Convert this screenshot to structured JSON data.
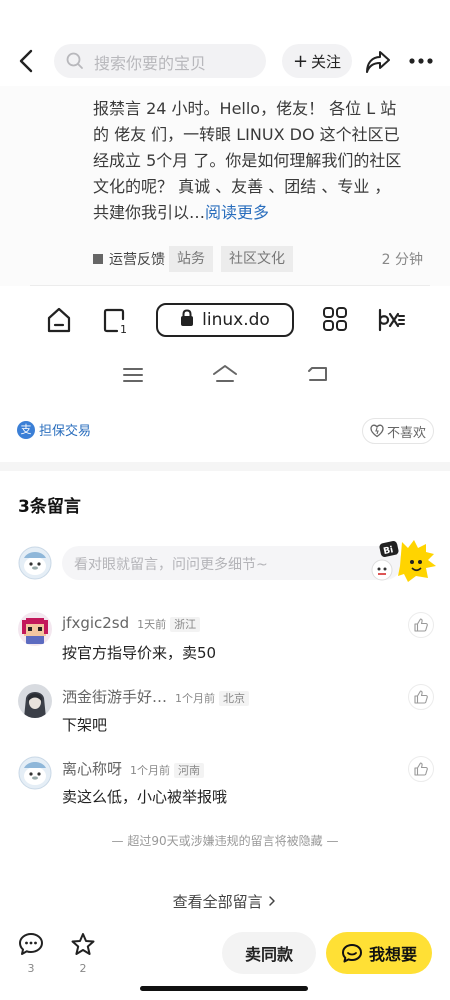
{
  "header": {
    "search_placeholder": "搜索你要的宝贝",
    "follow_label": "关注",
    "follow_plus": "+"
  },
  "post_preview": {
    "paragraph": "报禁言 24 小时。Hello，佬友！ 各位 L 站 的 佬友 们，一转眼 LINUX DO 这个社区已经成立 5个月 了。你是如何理解我们的社区文化的呢？ 真诚 、友善 、团结 、专业 ，共建你我引以…",
    "read_more": "阅读更多",
    "category": "运营反馈",
    "tags": [
      "站务",
      "社区文化"
    ],
    "time": "2 分钟"
  },
  "browser": {
    "url": "linux.do",
    "tab_count": "1"
  },
  "deal": {
    "label": "担保交易",
    "icon_glyph": "支",
    "dislike_label": "不喜欢"
  },
  "comments": {
    "title": "3条留言",
    "input_placeholder": "看对眼就留言，问问更多细节~",
    "items": [
      {
        "name": "jfxgic2sd",
        "time": "1天前",
        "location": "浙江",
        "text": "按官方指导价来，卖50"
      },
      {
        "name": "洒金街游手好…",
        "time": "1个月前",
        "location": "北京",
        "text": "下架吧"
      },
      {
        "name": "离心称呀",
        "time": "1个月前",
        "location": "河南",
        "text": "卖这么低，小心被举报哦"
      }
    ],
    "notice": "— 超过90天或涉嫌违规的留言将被隐藏 —",
    "view_all": "查看全部留言"
  },
  "bottom_bar": {
    "comment_count": "3",
    "fav_count": "2",
    "sell_same_label": "卖同款",
    "want_label": "我想要"
  },
  "colors": {
    "accent_yellow": "#ffe035",
    "link_blue": "#2a6ebd"
  }
}
